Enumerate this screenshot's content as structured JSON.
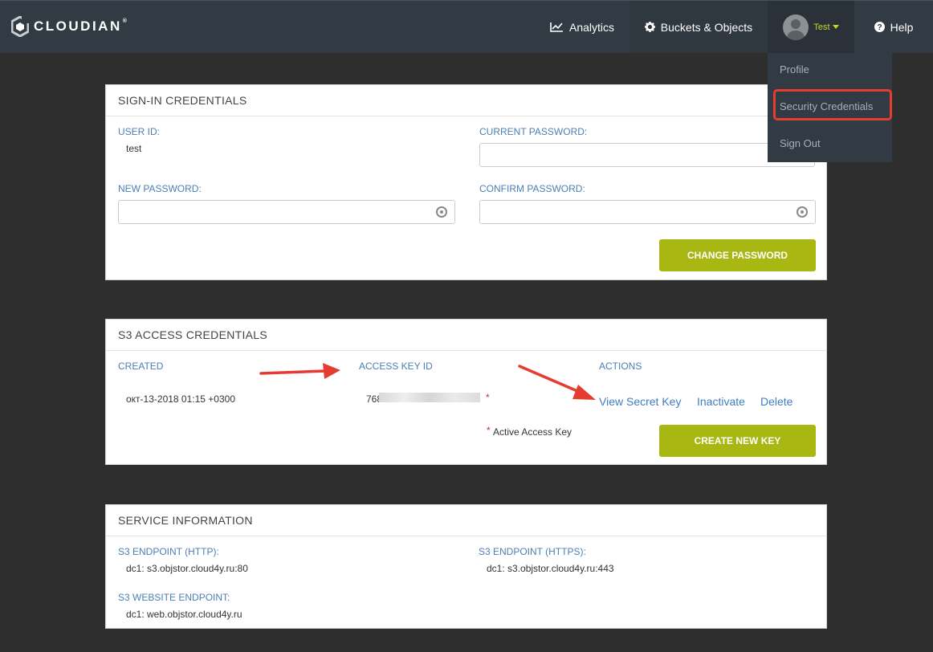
{
  "brand": {
    "name": "CLOUDIAN",
    "mark": "®"
  },
  "nav": {
    "analytics": "Analytics",
    "buckets": "Buckets & Objects",
    "user": "Test",
    "help": "Help"
  },
  "user_menu": {
    "items": [
      "Profile",
      "Security Credentials",
      "Sign Out"
    ]
  },
  "signin": {
    "title": "SIGN-IN CREDENTIALS",
    "user_id_label": "USER ID:",
    "user_id_value": "test",
    "current_password_label": "CURRENT PASSWORD:",
    "new_password_label": "NEW PASSWORD:",
    "confirm_password_label": "CONFIRM PASSWORD:",
    "change_button": "CHANGE PASSWORD"
  },
  "s3": {
    "title": "S3 ACCESS CREDENTIALS",
    "columns": [
      "CREATED",
      "ACCESS KEY ID",
      "ACTIONS"
    ],
    "row": {
      "created": "окт-13-2018 01:15 +0300",
      "key_prefix": "768",
      "star": "*",
      "actions": [
        "View Secret Key",
        "Inactivate",
        "Delete"
      ]
    },
    "legend": "Active Access Key",
    "create_button": "CREATE NEW KEY"
  },
  "service": {
    "title": "SERVICE INFORMATION",
    "http_label": "S3 ENDPOINT (HTTP):",
    "http_value": "dc1:  s3.objstor.cloud4y.ru:80",
    "https_label": "S3 ENDPOINT (HTTPS):",
    "https_value": "dc1:  s3.objstor.cloud4y.ru:443",
    "website_label": "S3 WEBSITE ENDPOINT:",
    "website_value": "dc1:  web.objstor.cloud4y.ru"
  },
  "colors": {
    "accent": "#a9b713",
    "link": "#3f7dc1",
    "label": "#4b7fb5",
    "highlight": "#e53c31"
  }
}
